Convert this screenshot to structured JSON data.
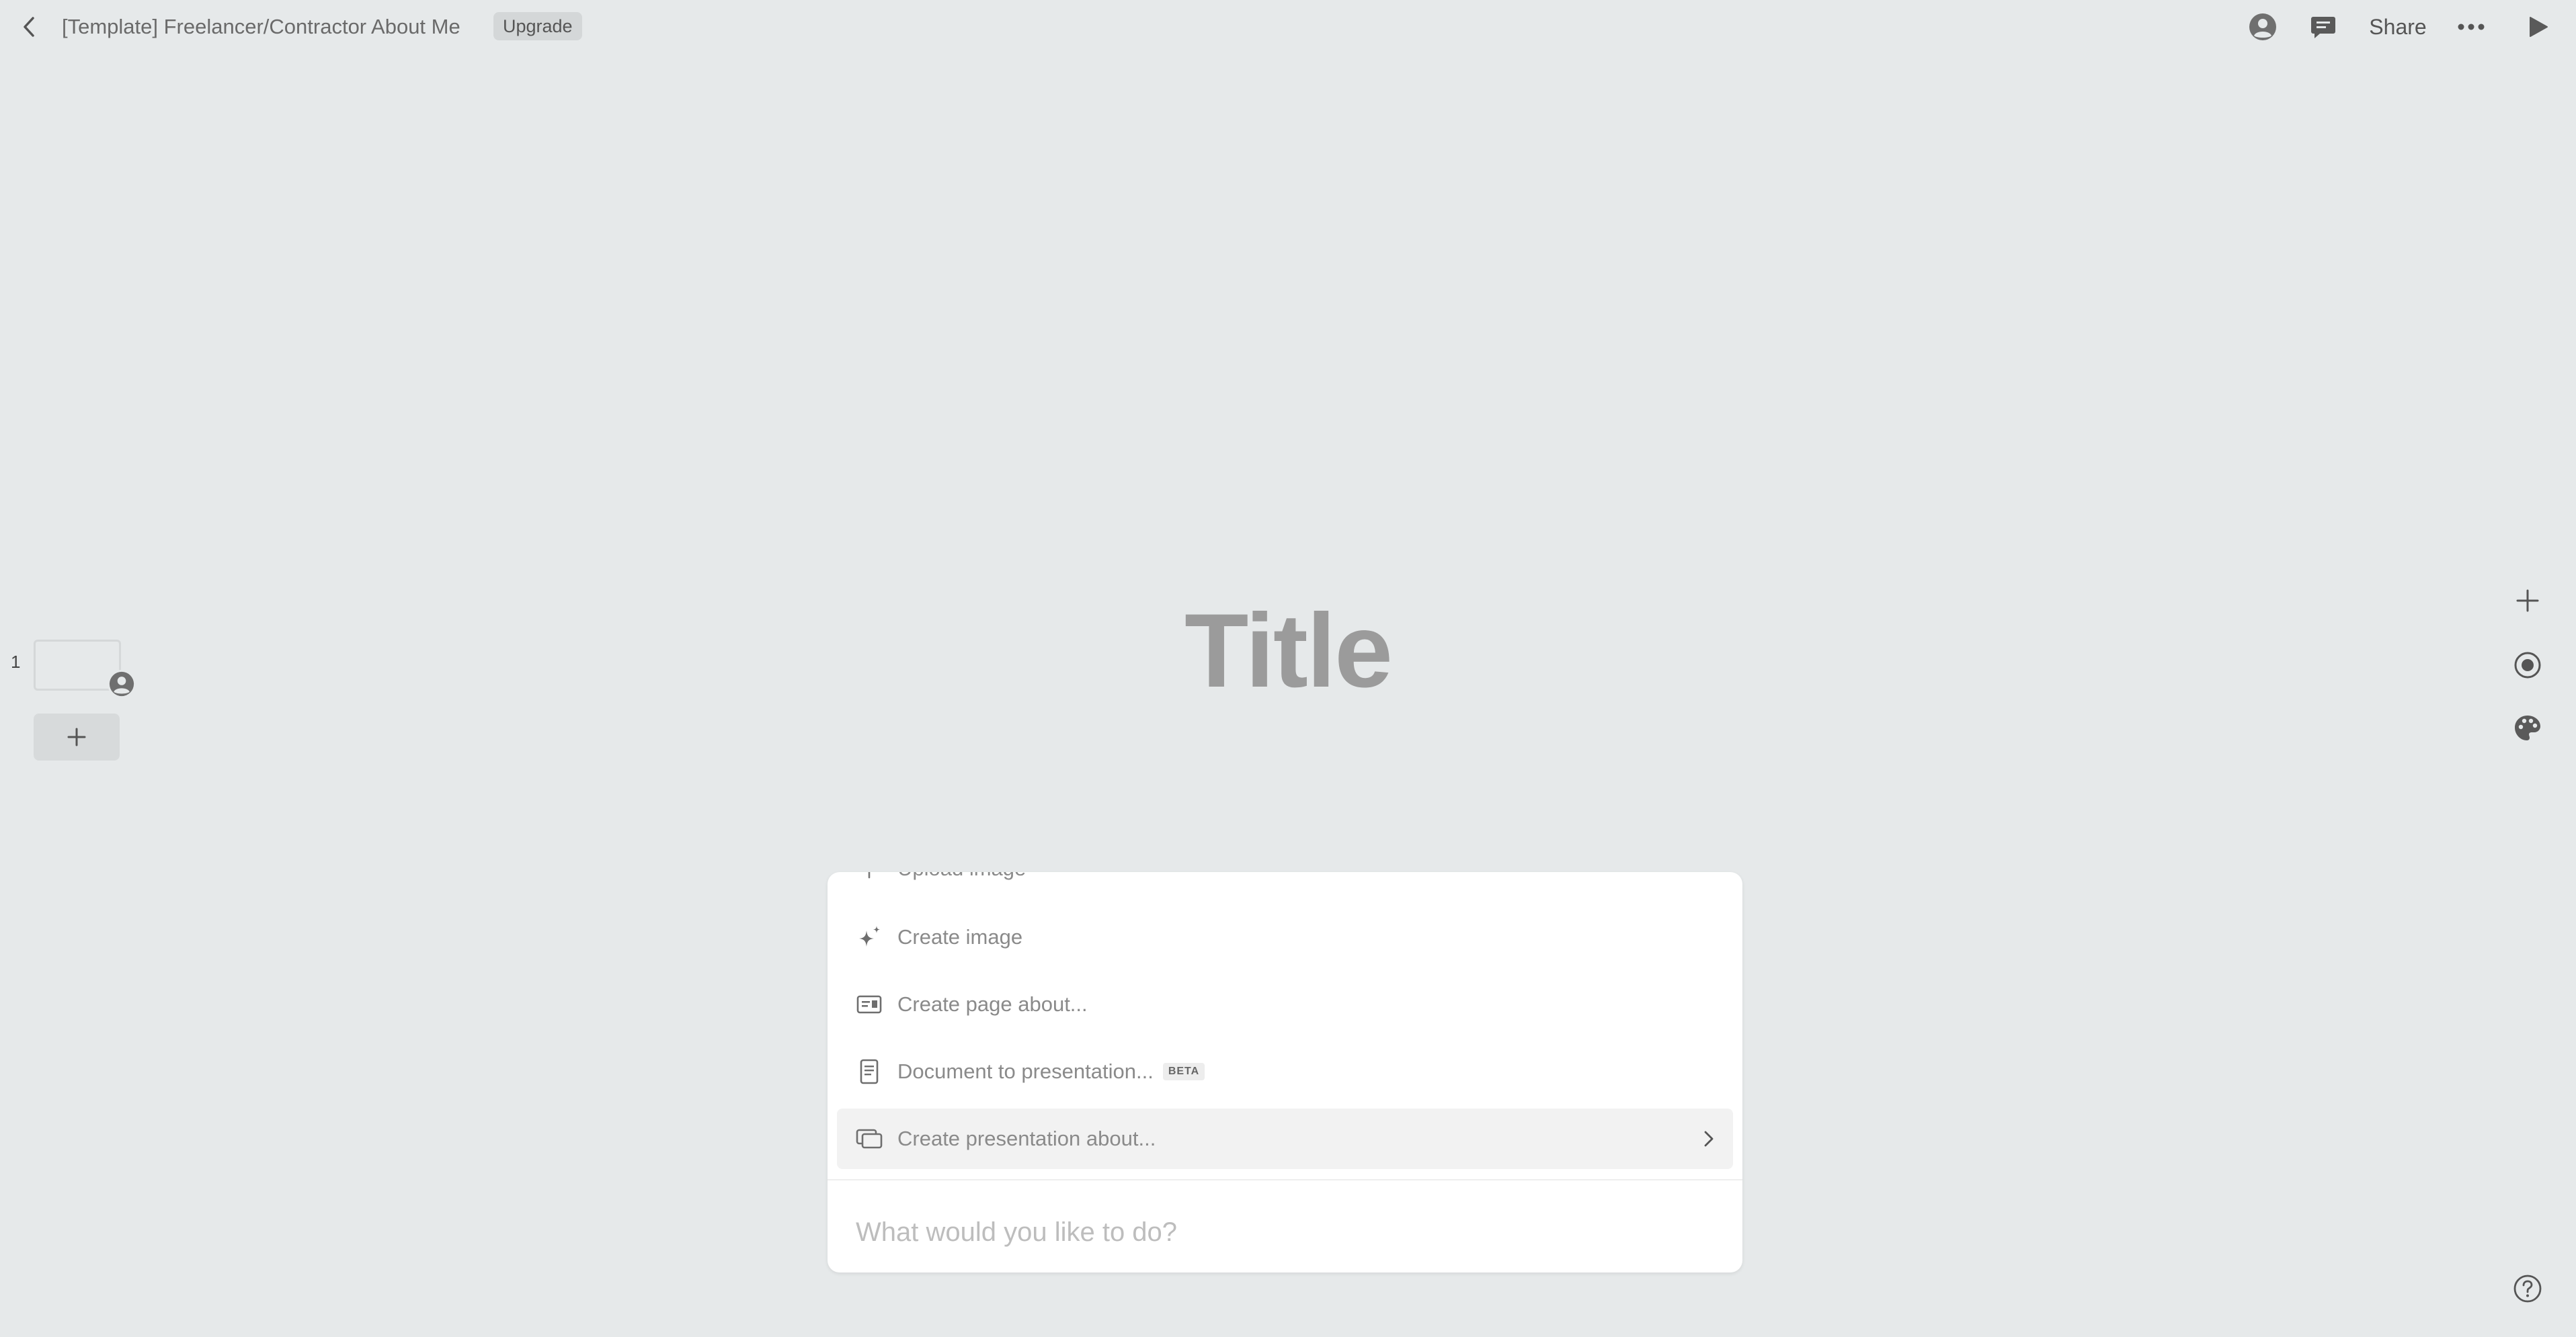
{
  "header": {
    "back_icon": "chevron-left-icon",
    "title": "[Template] Freelancer/Contractor About Me",
    "upgrade_label": "Upgrade",
    "share_label": "Share",
    "user_icon": "user-avatar-icon",
    "comment_icon": "comment-icon",
    "more_icon": "more-horizontal-icon",
    "present_icon": "play-icon"
  },
  "slides_panel": {
    "slides": [
      {
        "number": "1"
      }
    ],
    "add_icon": "plus-icon"
  },
  "canvas": {
    "title_placeholder": "Title"
  },
  "right_rail": {
    "items": [
      "plus-icon",
      "record-icon",
      "palette-icon"
    ],
    "help_icon": "help-icon"
  },
  "ai_menu": {
    "items": [
      {
        "label": "Upload image",
        "icon": "upload-icon"
      },
      {
        "label": "Create image",
        "icon": "sparkle-icon"
      },
      {
        "label": "Create page about...",
        "icon": "page-layout-icon"
      },
      {
        "label": "Document to presentation...",
        "icon": "document-icon",
        "badge": "BETA"
      },
      {
        "label": "Create presentation about...",
        "icon": "slides-icon",
        "active": true,
        "has_submenu": true
      }
    ],
    "input_placeholder": "What would you like to do?"
  },
  "colors": {
    "background": "#e6e9ea",
    "panel": "#ffffff",
    "title_text": "#9b9b9b",
    "active_item": "#f2f2f2"
  }
}
